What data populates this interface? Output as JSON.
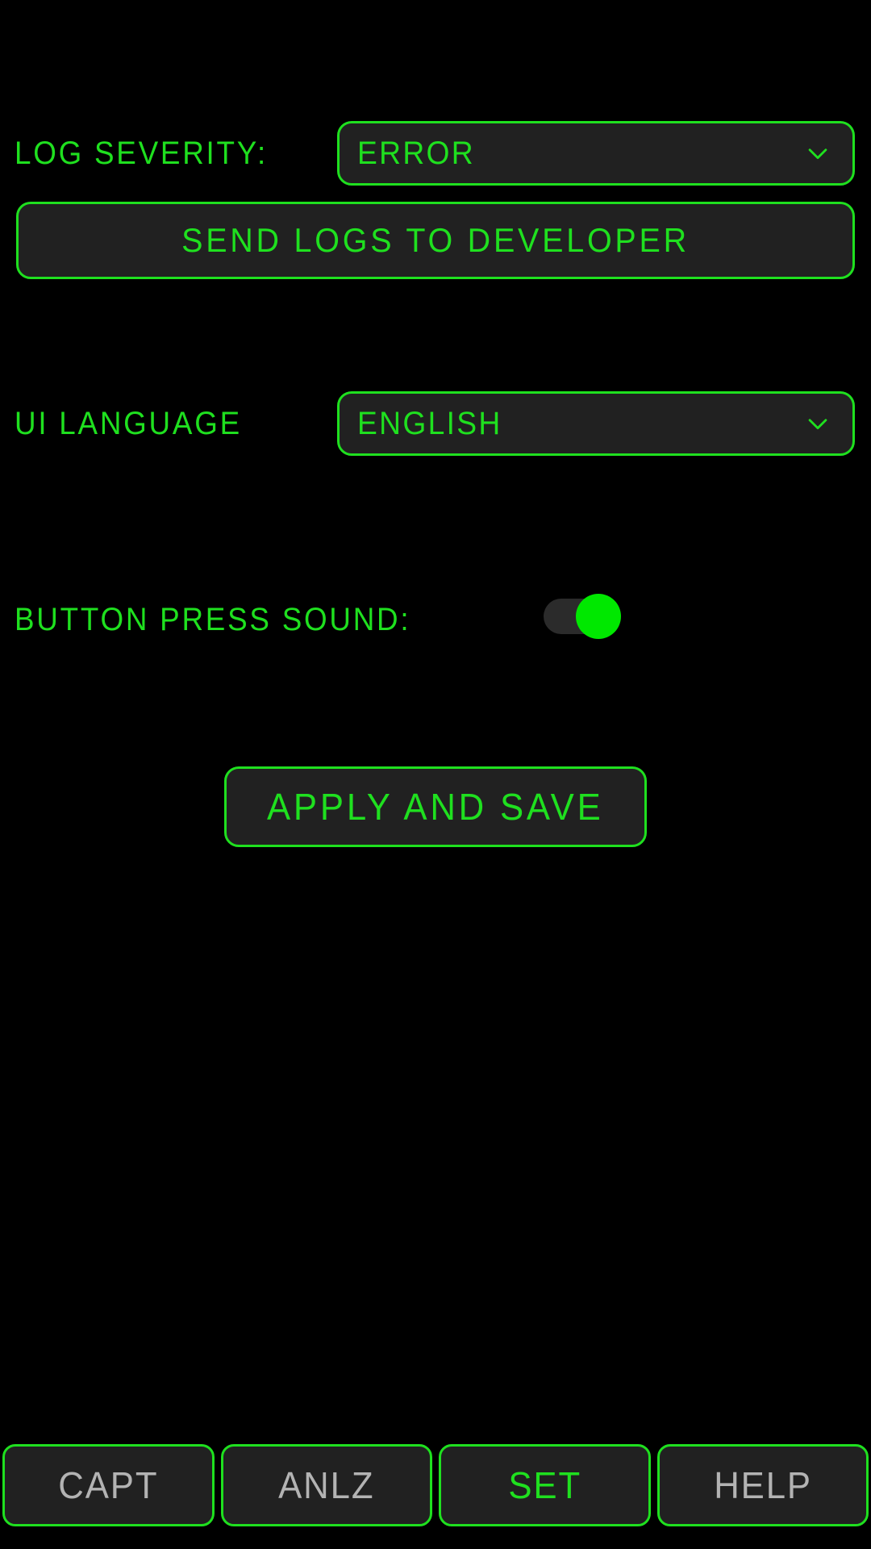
{
  "screen": {
    "name": "settings-screen",
    "background_color": "#000000",
    "accent_color": "#1fe01f",
    "panel_color": "#212121",
    "inactive_text_color": "#b3b3b3"
  },
  "settings": {
    "log_severity": {
      "label": "LOG SEVERITY:",
      "value": "ERROR",
      "icon": "chevron-down-icon"
    },
    "send_logs": {
      "label": "SEND LOGS TO DEVELOPER"
    },
    "ui_language": {
      "label": "UI LANGUAGE",
      "value": "ENGLISH",
      "icon": "chevron-down-icon"
    },
    "button_press_sound": {
      "label": "BUTTON PRESS SOUND:",
      "state": "on",
      "knob_color": "#00e800",
      "track_color": "#2b2b2b"
    },
    "apply": {
      "label": "APPLY AND SAVE"
    }
  },
  "bottom_nav": {
    "items": [
      {
        "label": "CAPT",
        "active": false
      },
      {
        "label": "ANLZ",
        "active": false
      },
      {
        "label": "SET",
        "active": true
      },
      {
        "label": "HELP",
        "active": false
      }
    ]
  }
}
